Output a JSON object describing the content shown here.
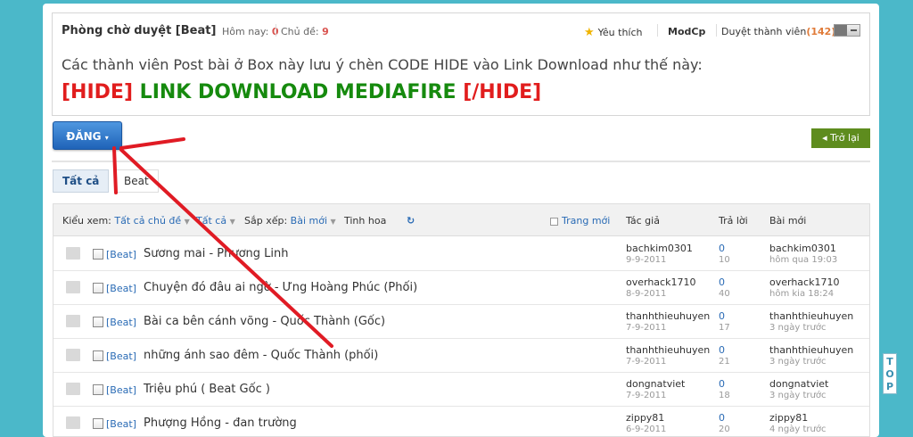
{
  "forum": {
    "title": "Phòng chờ duyệt [Beat]",
    "today_label": "Hôm nay:",
    "today_count": "0",
    "topics_label": "Chủ đề:",
    "topics_count": "9",
    "favorite_label": "Yêu thích",
    "modcp_label": "ModCp",
    "approve_label": "Duyệt thành viên",
    "approve_count": "(142)"
  },
  "notice": {
    "text": "Các thành viên Post bài ở Box này lưu ý chèn CODE HIDE vào Link Download như thế này:",
    "open_tag": "[HIDE]",
    "link_text": "LINK DOWNLOAD MEDIAFIRE",
    "close_tag": "[/HIDE]"
  },
  "toolbar": {
    "post_label": "ĐĂNG",
    "back_label": "Trở lại"
  },
  "tabs": [
    {
      "label": "Tất cả"
    },
    {
      "label": "Beat"
    }
  ],
  "table": {
    "view_label": "Kiểu xem:",
    "filter_all_topics": "Tất cả chủ đề",
    "filter_all": "Tất cả",
    "sort_label": "Sắp xếp:",
    "sort_value": "Bài mới",
    "featured_label": "Tinh hoa",
    "new_page_label": "Trang mới",
    "col_author": "Tác giả",
    "col_replies": "Trả lời",
    "col_last": "Bài mới"
  },
  "topics": [
    {
      "prefix": "[Beat]",
      "title": "Sương mai - Phương Linh",
      "author": "bachkim0301",
      "date": "9-9-2011",
      "replies": "0",
      "views": "10",
      "last_user": "bachkim0301",
      "last_time": "hôm qua 19:03"
    },
    {
      "prefix": "[Beat]",
      "title": "Chuyện đó đâu ai ngờ - Ưng Hoàng Phúc (Phối)",
      "author": "overhack1710",
      "date": "8-9-2011",
      "replies": "0",
      "views": "40",
      "last_user": "overhack1710",
      "last_time": "hôm kia 18:24"
    },
    {
      "prefix": "[Beat]",
      "title": "Bài ca bên cánh võng - Quốc Thành (Gốc)",
      "author": "thanhthieuhuyen",
      "date": "7-9-2011",
      "replies": "0",
      "views": "17",
      "last_user": "thanhthieuhuyen",
      "last_time": "3 ngày trước"
    },
    {
      "prefix": "[Beat]",
      "title": "những ánh sao đêm - Quốc Thành (phối)",
      "author": "thanhthieuhuyen",
      "date": "7-9-2011",
      "replies": "0",
      "views": "21",
      "last_user": "thanhthieuhuyen",
      "last_time": "3 ngày trước"
    },
    {
      "prefix": "[Beat]",
      "title": "Triệu phú ( Beat Gốc )",
      "author": "dongnatviet",
      "date": "7-9-2011",
      "replies": "0",
      "views": "18",
      "last_user": "dongnatviet",
      "last_time": "3 ngày trước"
    },
    {
      "prefix": "[Beat]",
      "title": "Phượng Hồng - đan trường",
      "author": "zippy81",
      "date": "6-9-2011",
      "replies": "0",
      "views": "20",
      "last_user": "zippy81",
      "last_time": "4 ngày trước"
    }
  ],
  "scroll_top_label": "TOP",
  "colors": {
    "background": "#4bb8c9",
    "accent_blue": "#2a6bb5",
    "hide_red": "#e11d1d",
    "link_green": "#168a0e",
    "back_green": "#5e8c1e",
    "arrow_red": "#e01b24"
  }
}
